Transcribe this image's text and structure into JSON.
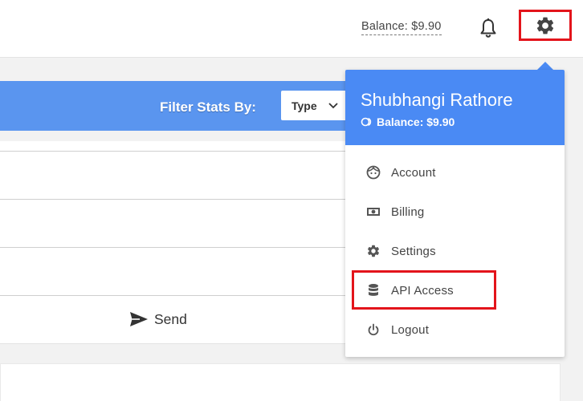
{
  "header": {
    "balance_label": "Balance: $9.90",
    "notifications_icon": "bell-icon",
    "settings_icon": "gear-icon"
  },
  "filter": {
    "label": "Filter Stats By:",
    "select_value": "Type"
  },
  "form": {
    "send_label": "Send"
  },
  "dropdown": {
    "user_name": "Shubhangi Rathore",
    "balance": "Balance: $9.90",
    "items": [
      {
        "label": "Account",
        "icon": "face-icon"
      },
      {
        "label": "Billing",
        "icon": "money-icon"
      },
      {
        "label": "Settings",
        "icon": "gear-icon"
      },
      {
        "label": "API Access",
        "icon": "database-icon"
      },
      {
        "label": "Logout",
        "icon": "power-icon"
      }
    ]
  },
  "colors": {
    "accent": "#4a8af4",
    "filter_bar": "#5a95ef",
    "highlight": "#e3141b"
  }
}
